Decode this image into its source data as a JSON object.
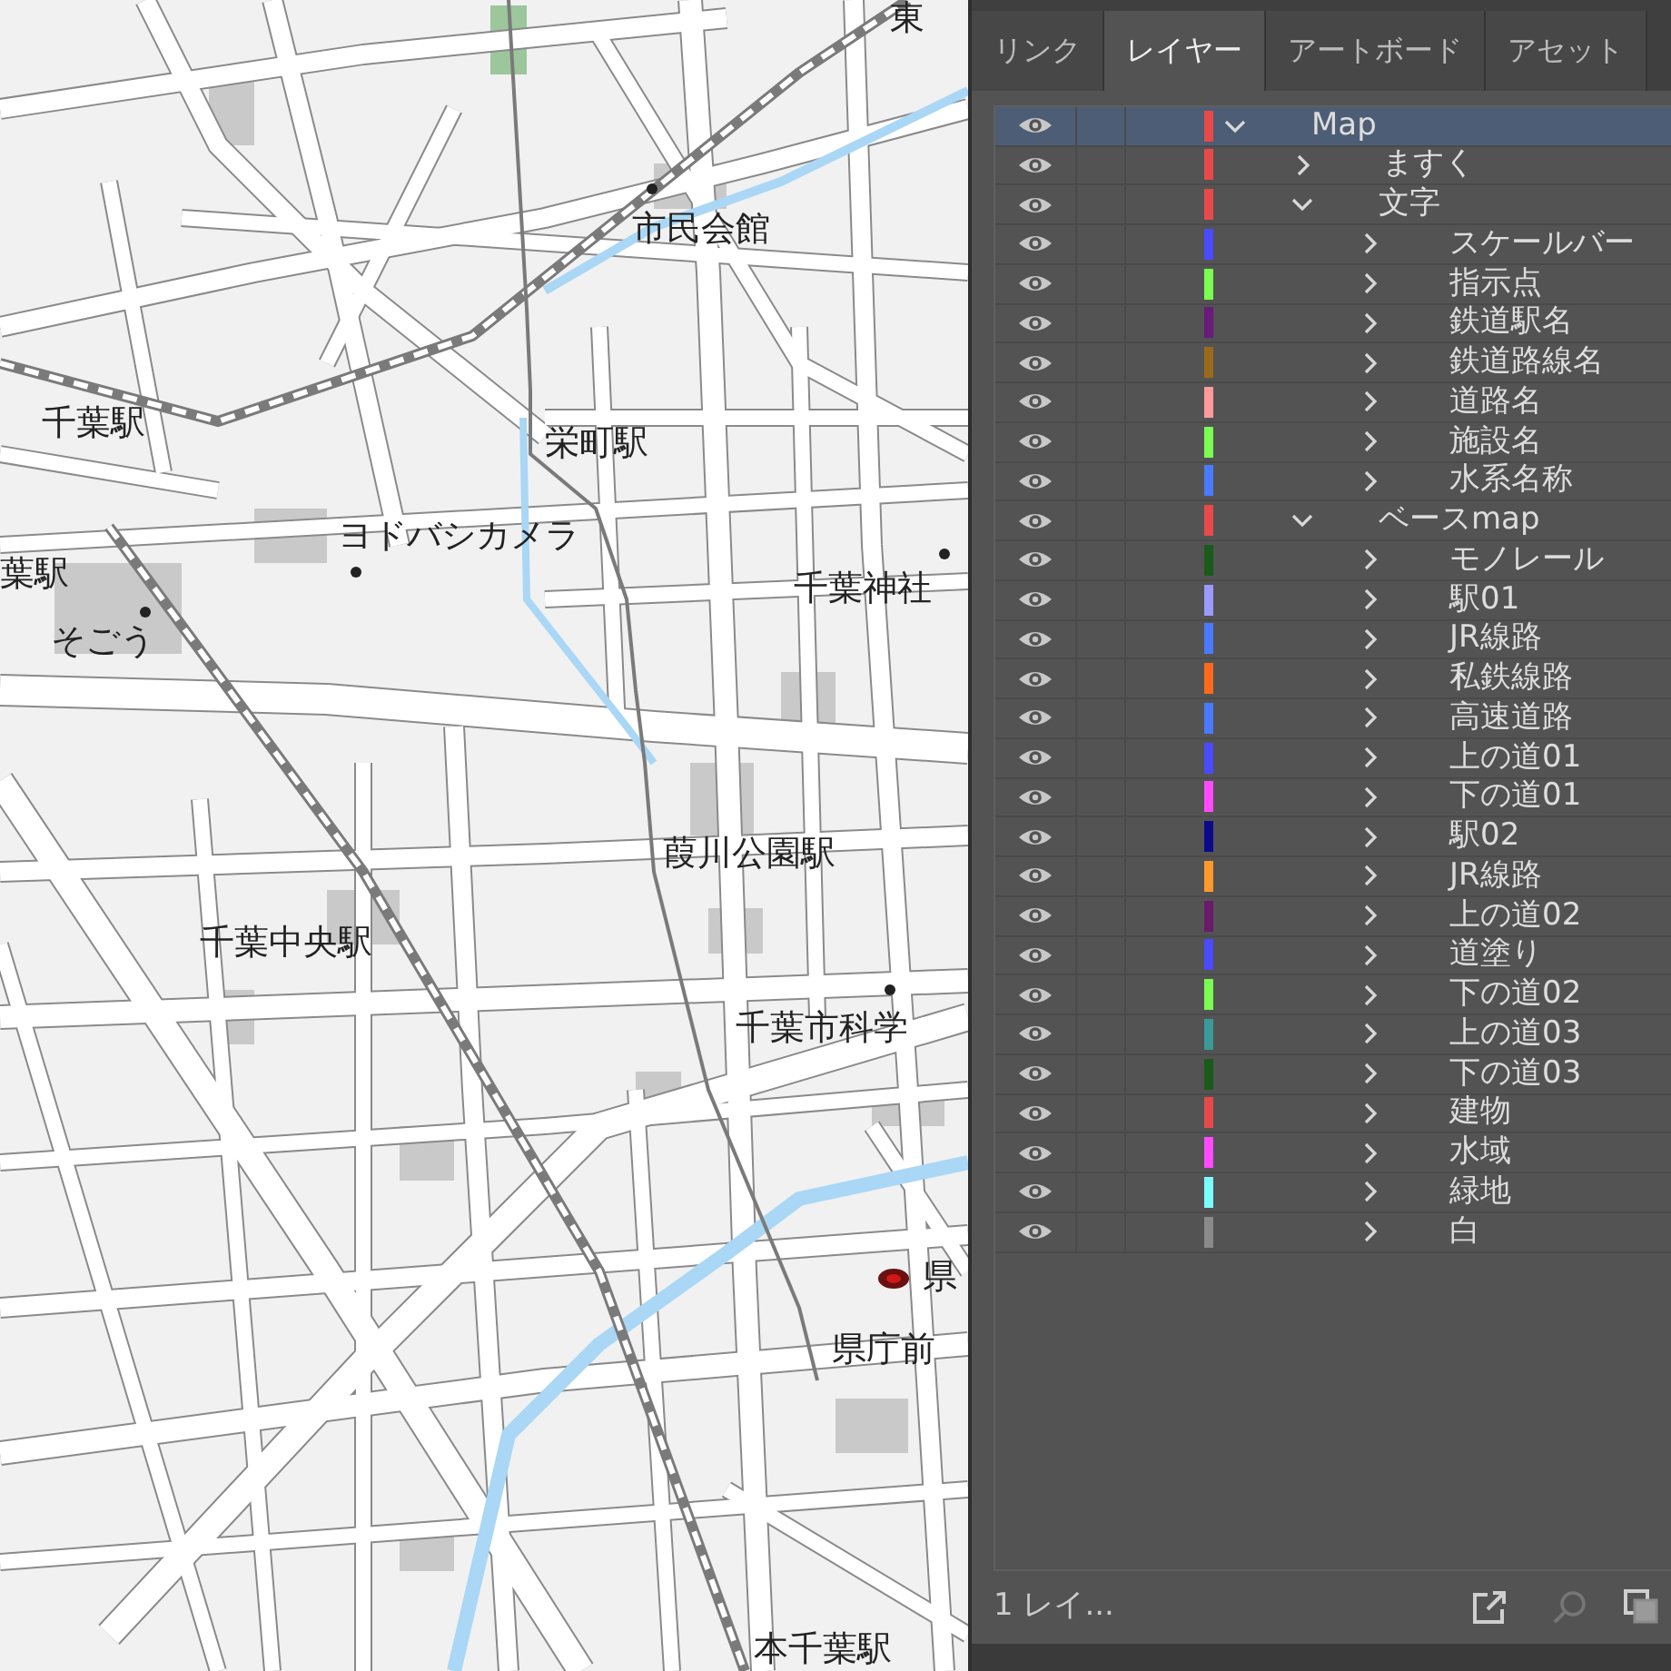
{
  "map": {
    "labels": [
      {
        "text": "東"
      },
      {
        "text": "市民会館"
      },
      {
        "text": "千葉駅"
      },
      {
        "text": "栄町駅"
      },
      {
        "text": "ヨドバシカメラ"
      },
      {
        "text": "葉駅"
      },
      {
        "text": "千葉神社"
      },
      {
        "text": "そごう"
      },
      {
        "text": "葭川公園駅"
      },
      {
        "text": "千葉中央駅"
      },
      {
        "text": "千葉市科学"
      },
      {
        "text": "県"
      },
      {
        "text": "県庁前"
      },
      {
        "text": "本千葉駅"
      }
    ]
  },
  "panel": {
    "tabs": [
      {
        "label": "リンク",
        "selected": false
      },
      {
        "label": "レイヤー",
        "selected": true
      },
      {
        "label": "アートボード",
        "selected": false
      },
      {
        "label": "アセット",
        "selected": false
      }
    ],
    "layers": [
      {
        "name": "Map",
        "color": "#e84a4a",
        "expanded": true,
        "selected": true,
        "children": [
          {
            "name": "ますく",
            "color": "#e84a4a",
            "expanded": false,
            "selected": false
          },
          {
            "name": "文字",
            "color": "#e84a4a",
            "expanded": true,
            "selected": false,
            "children": [
              {
                "name": "スケールバー",
                "color": "#4a4aff",
                "expanded": false,
                "selected": false
              },
              {
                "name": "指示点",
                "color": "#7aff50",
                "expanded": false,
                "selected": false
              },
              {
                "name": "鉄道駅名",
                "color": "#6a1a7a",
                "expanded": false,
                "selected": false
              },
              {
                "name": "鉄道路線名",
                "color": "#9a6a1a",
                "expanded": false,
                "selected": false
              },
              {
                "name": "道路名",
                "color": "#ff9a9a",
                "expanded": false,
                "selected": false
              },
              {
                "name": "施設名",
                "color": "#7aff50",
                "expanded": false,
                "selected": false
              },
              {
                "name": "水系名称",
                "color": "#4a7aff",
                "expanded": false,
                "selected": false
              }
            ]
          },
          {
            "name": "ベースmap",
            "color": "#e84a4a",
            "expanded": true,
            "selected": false,
            "children": [
              {
                "name": "モノレール",
                "color": "#1a5a1a",
                "expanded": false,
                "selected": false
              },
              {
                "name": "駅01",
                "color": "#9a9aff",
                "expanded": false,
                "selected": false
              },
              {
                "name": "JR線路",
                "color": "#4a7aff",
                "expanded": false,
                "selected": false
              },
              {
                "name": "私鉄線路",
                "color": "#ff6a1a",
                "expanded": false,
                "selected": false
              },
              {
                "name": "高速道路",
                "color": "#4a7aff",
                "expanded": false,
                "selected": false
              },
              {
                "name": "上の道01",
                "color": "#4a4aff",
                "expanded": false,
                "selected": false
              },
              {
                "name": "下の道01",
                "color": "#ff4aff",
                "expanded": false,
                "selected": false
              },
              {
                "name": "駅02",
                "color": "#0a0a8a",
                "expanded": false,
                "selected": false
              },
              {
                "name": "JR線路",
                "color": "#ff9a2a",
                "expanded": false,
                "selected": false
              },
              {
                "name": "上の道02",
                "color": "#6a1a6a",
                "expanded": false,
                "selected": false
              },
              {
                "name": "道塗り",
                "color": "#4a4aff",
                "expanded": false,
                "selected": false
              },
              {
                "name": "下の道02",
                "color": "#7aff50",
                "expanded": false,
                "selected": false
              },
              {
                "name": "上の道03",
                "color": "#3a9a9a",
                "expanded": false,
                "selected": false
              },
              {
                "name": "下の道03",
                "color": "#1a5a1a",
                "expanded": false,
                "selected": false
              },
              {
                "name": "建物",
                "color": "#e84a4a",
                "expanded": false,
                "selected": false
              },
              {
                "name": "水域",
                "color": "#ff4aff",
                "expanded": false,
                "selected": false
              },
              {
                "name": "緑地",
                "color": "#7affff",
                "expanded": false,
                "selected": false
              },
              {
                "name": "白",
                "color": "#8a8a8a",
                "expanded": false,
                "selected": false
              }
            ]
          }
        ]
      }
    ],
    "footer": {
      "count": "1 レイ..."
    }
  }
}
